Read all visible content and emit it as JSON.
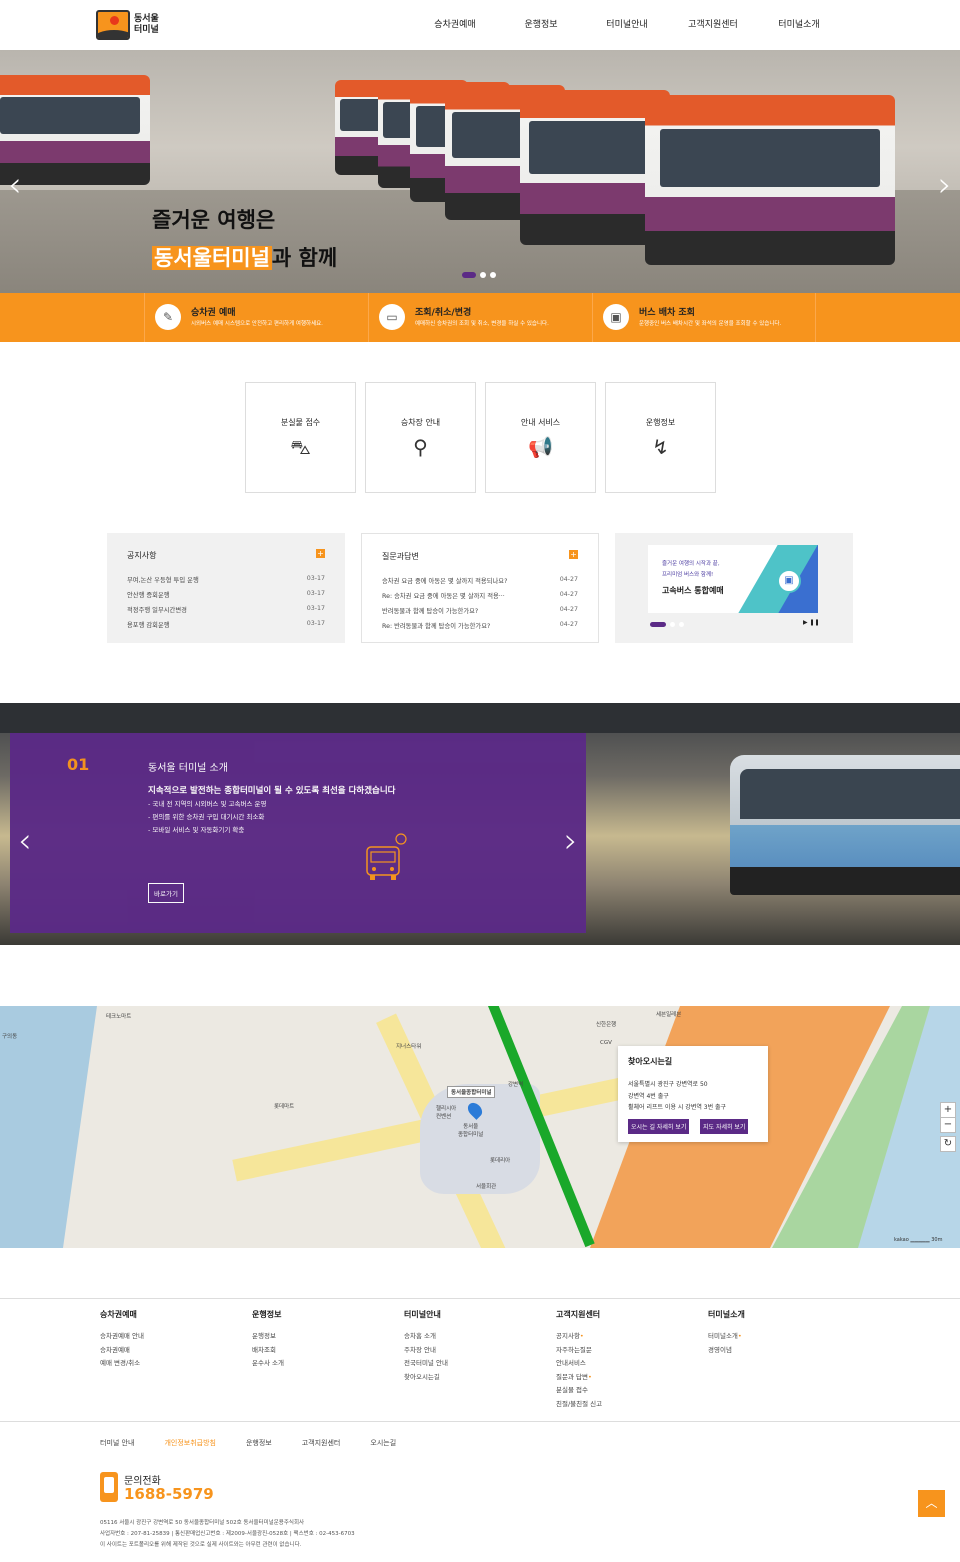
{
  "header": {
    "logo_text": "동서울\n터미널",
    "nav": [
      "승차권예매",
      "운행정보",
      "터미널안내",
      "고객지원센터",
      "터미널소개"
    ]
  },
  "hero": {
    "line1": "즐거운 여행은",
    "line2_highlight": "동서울터미널",
    "line2_rest": "과 함께",
    "prev": "‹",
    "next": "›"
  },
  "services": [
    {
      "icon": "ticket-icon",
      "glyph": "✎",
      "title": "승차권 예매",
      "desc": "시외버스 예매 시스템으로 안전하고 편리하게 여행하세요."
    },
    {
      "icon": "monitor-icon",
      "glyph": "▭",
      "title": "조회/취소/변경",
      "desc": "예매하신 승차권의 조회 및 취소, 변경을 하실 수 있습니다."
    },
    {
      "icon": "bus-icon",
      "glyph": "▣",
      "title": "버스 배차 조회",
      "desc": "운행중인 버스 배차시간 및 좌석의 운영을 조회할 수 있습니다."
    }
  ],
  "quick": [
    {
      "label": "분실물 접수",
      "icon": "lost-bag-icon",
      "glyph": "⛍"
    },
    {
      "label": "승차장 안내",
      "icon": "location-pin-icon",
      "glyph": "⚲"
    },
    {
      "label": "안내 서비스",
      "icon": "megaphone-icon",
      "glyph": "📢"
    },
    {
      "label": "운행정보",
      "icon": "route-icon",
      "glyph": "↯"
    }
  ],
  "notice": {
    "title": "공지사항",
    "items": [
      {
        "text": "부여,논산 우등형 투입 운행",
        "date": "03-17"
      },
      {
        "text": "안산행 증회운행",
        "date": "03-17"
      },
      {
        "text": "적정주행 일부시간변경",
        "date": "03-17"
      },
      {
        "text": "용포행 감회운행",
        "date": "03-17"
      }
    ]
  },
  "qna": {
    "title": "질문과답변",
    "items": [
      {
        "text": "승차권 요금 중에 아동은 몇 살까지 적용되나요?",
        "date": "04-27"
      },
      {
        "text": "Re: 승차권 요금 중에 아동은 몇 살까지 적용···",
        "date": "04-27"
      },
      {
        "text": "반려동물과 함께 탑승이 가능한가요?",
        "date": "04-27"
      },
      {
        "text": "Re: 반려동물과 함께 탑승이 가능한가요?",
        "date": "04-27"
      }
    ]
  },
  "banner": {
    "line1": "즐거운 여행의 시작과 끝,",
    "line2": "프리미엄 버스와 함께!",
    "line3": "고속버스 통합예매",
    "controls": "▶ ❚❚"
  },
  "intro": {
    "num": "01",
    "title": "동서울 터미널 소개",
    "subtitle": "지속적으로 발전하는 종합터미널이 될 수 있도록 최선을 다하겠습니다",
    "bullets": [
      "- 국내 전 지역의 시외버스 및 고속버스 운영",
      "- 편의를 위한 승차권 구입 대기시간 최소화",
      "- 모바일 서비스 및 자동화기기 확충"
    ],
    "button": "바로가기",
    "prev": "‹",
    "next": "›"
  },
  "map": {
    "labels": [
      "동서울종합터미널",
      "동서울\n종합터미널",
      "헬리시아\n컨벤션",
      "롯데리아",
      "서울회관",
      "지너스타워",
      "테크노마트",
      "신한은행",
      "CGV",
      "세븐일레븐",
      "강변역",
      "롯데마트",
      "구의동"
    ],
    "card_title": "찾아오시는길",
    "card_lines": [
      "서울특별시 광진구 강변역로 50",
      "강변역 4번 출구",
      "휠체어 리프트 이용 시 강변역 3번 출구"
    ],
    "btn_route": "오시는 길 자세히 보기",
    "btn_map": "지도 자세히 보기",
    "zoom_in": "+",
    "zoom_out": "−",
    "refresh": "↻",
    "scale": "kakao ▁▁▁▁▁ 30m"
  },
  "footer_nav": [
    {
      "title": "승차권예매",
      "items": [
        "승차권예매 안내",
        "승차권예매",
        "예매 변경/취소"
      ]
    },
    {
      "title": "운행정보",
      "items": [
        "운행정보",
        "배차조회",
        "운수사 소개"
      ]
    },
    {
      "title": "터미널안내",
      "items": [
        "승차홈 소개",
        "주차장 안내",
        "전국터미널 안내",
        "찾아오시는길"
      ]
    },
    {
      "title": "고객지원센터",
      "items": [
        "공지사항",
        "자주하는질문",
        "안내서비스",
        "질문과 답변",
        "분실물 접수",
        "친절/불친절 신고"
      ]
    },
    {
      "title": "터미널소개",
      "items": [
        "터미널소개",
        "경영이념"
      ]
    }
  ],
  "footer_links": [
    "터미널 안내",
    "개인정보취급방침",
    "운행정보",
    "고객지원센터",
    "오시는길"
  ],
  "call": {
    "label": "문의전화",
    "number": "1688-5979"
  },
  "info": [
    "05116 서울시 광진구 강변역로 50 동서울종합터미널 502호 동서울터미널운용주식회사",
    "사업자번호 : 207-81-25839 | 통신판매업신고번호 : 제2009-서울광진-0528호 | 팩스번호 : 02-453-6703",
    "이 사이트는 포트폴리오를 위해 제작된 것으로 실제 사이트와는 아무런 관련이 없습니다."
  ],
  "to_top": "︿",
  "colors": {
    "accent": "#f7941d",
    "purple": "#5b2a86"
  }
}
